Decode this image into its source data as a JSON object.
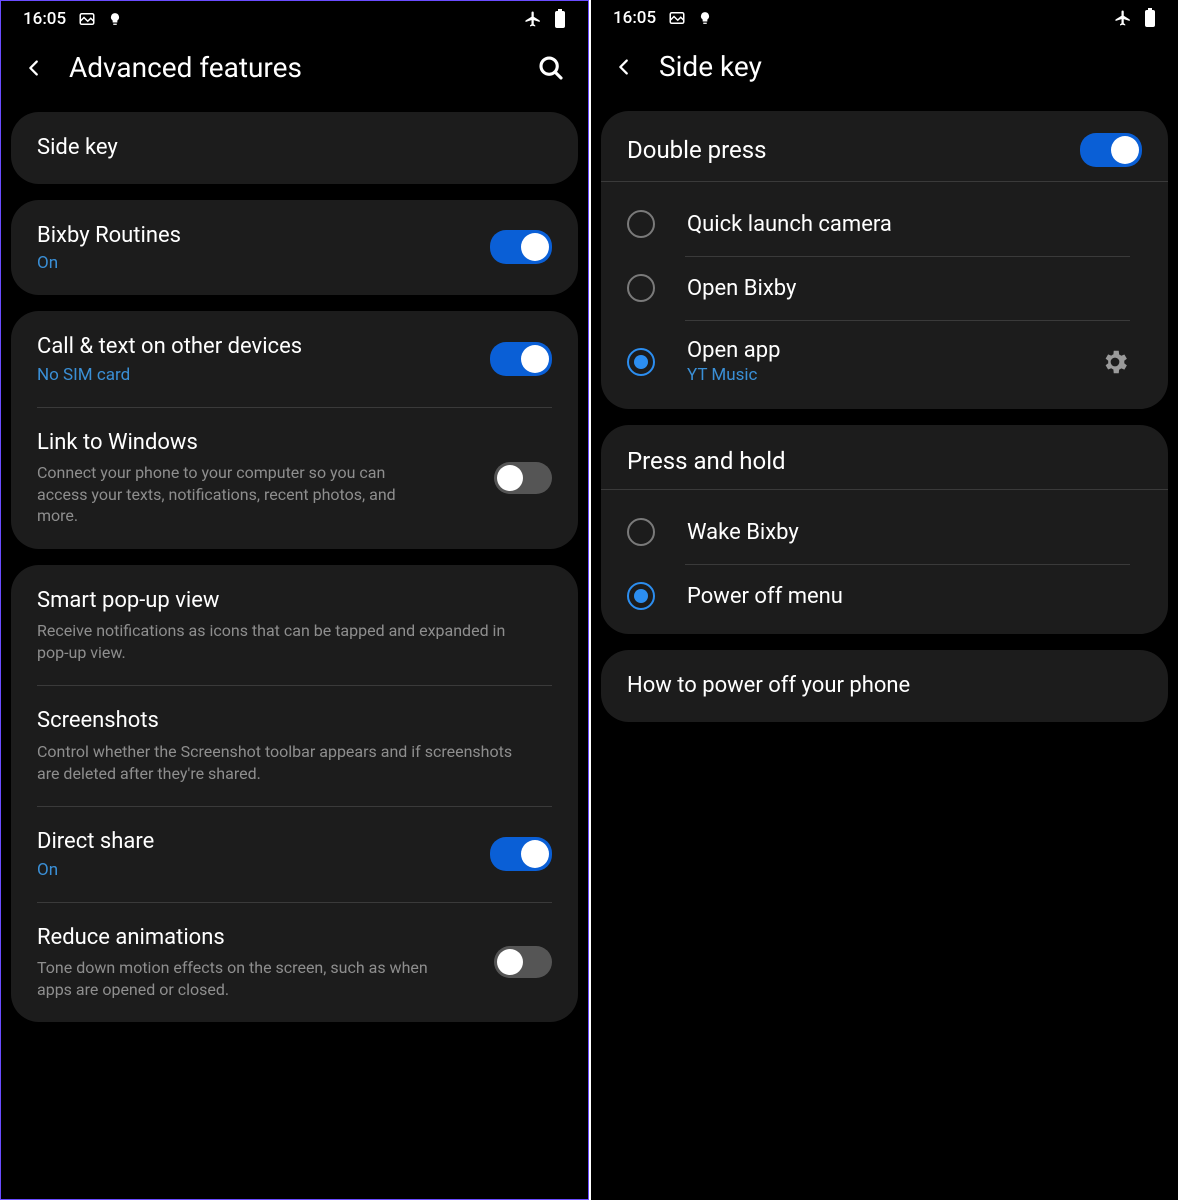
{
  "status": {
    "time": "16:05"
  },
  "left": {
    "title": "Advanced features",
    "sidekey": "Side key",
    "bixby": {
      "title": "Bixby Routines",
      "sub": "On"
    },
    "calltext": {
      "title": "Call & text on other devices",
      "sub": "No SIM card"
    },
    "linkwin": {
      "title": "Link to Windows",
      "sub": "Connect your phone to your computer so you can access your texts, notifications, recent photos, and more."
    },
    "smartpopup": {
      "title": "Smart pop-up view",
      "sub": "Receive notifications as icons that can be tapped and expanded in pop-up view."
    },
    "screenshots": {
      "title": "Screenshots",
      "sub": "Control whether the Screenshot toolbar appears and if screenshots are deleted after they're shared."
    },
    "directshare": {
      "title": "Direct share",
      "sub": "On"
    },
    "reduce": {
      "title": "Reduce animations",
      "sub": "Tone down motion effects on the screen, such as when apps are opened or closed."
    }
  },
  "right": {
    "title": "Side key",
    "double": "Double press",
    "opt1": "Quick launch camera",
    "opt2": "Open Bixby",
    "opt3": {
      "title": "Open app",
      "sub": "YT Music"
    },
    "hold": "Press and hold",
    "hopt1": "Wake Bixby",
    "hopt2": "Power off menu",
    "howto": "How to power off your phone"
  }
}
